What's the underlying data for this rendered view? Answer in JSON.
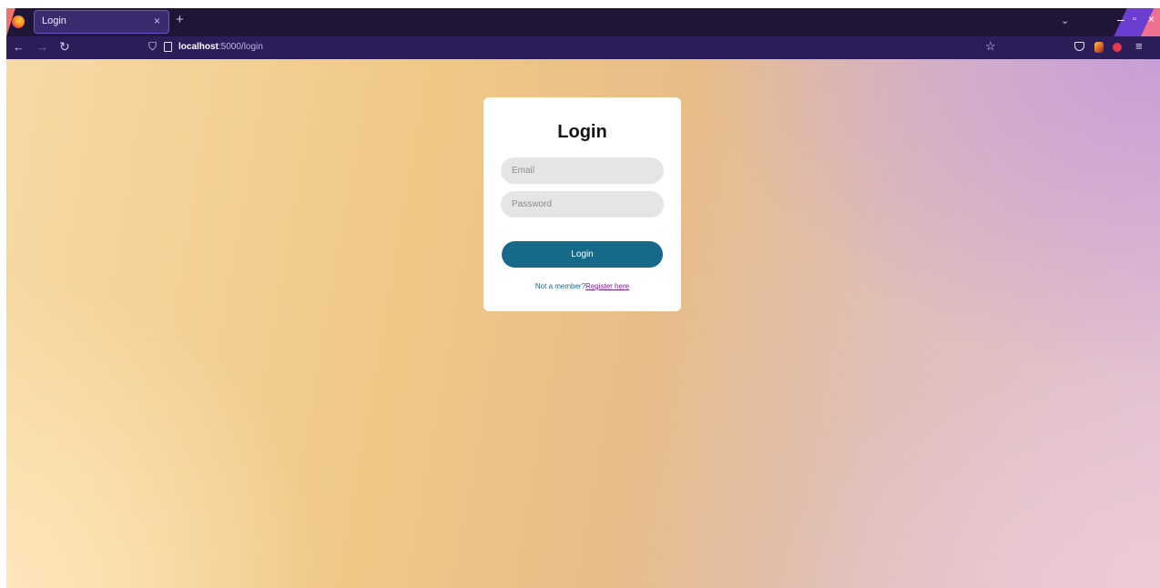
{
  "browser": {
    "tab": {
      "title": "Login",
      "close_glyph": "×"
    },
    "new_tab_glyph": "+",
    "tablist_glyph": "⌄",
    "window_controls": {
      "minimize": "–",
      "maximize": "▫",
      "close": "×"
    },
    "nav": {
      "back": "←",
      "forward": "→",
      "reload": "↻"
    },
    "url": {
      "host": "localhost",
      "rest": ":5000/login"
    },
    "bookmark_glyph": "☆",
    "menu_glyph": "≡",
    "icons": {
      "logo": "firefox-logo-icon",
      "shield": "tracking-shield-icon",
      "page": "page-icon",
      "pocket": "pocket-icon",
      "extension_1": "extension-icon",
      "extension_2": "extension-icon"
    },
    "colors": {
      "tabbar": "#1f1537",
      "navbar": "#2c1d58",
      "tab": "#3a2a6e"
    }
  },
  "login_card": {
    "title": "Login",
    "email_placeholder": "Email",
    "password_placeholder": "Password",
    "submit_label": "Login",
    "register_prompt": "Not a member?",
    "register_link": "Register here",
    "colors": {
      "button": "#17698a",
      "link": "#7a1fa2",
      "input_bg": "#e5e5e5"
    }
  }
}
